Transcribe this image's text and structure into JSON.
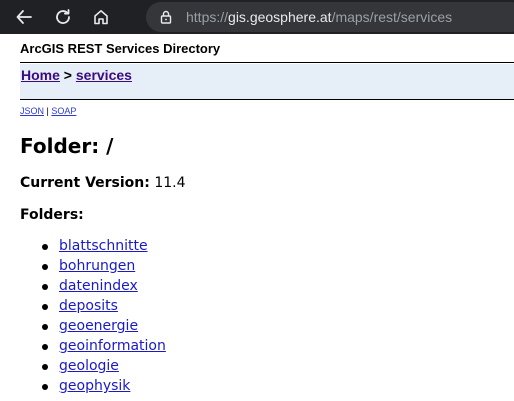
{
  "browser": {
    "url_scheme": "https://",
    "url_host": "gis.geosphere.at",
    "url_path": "/maps/rest/services",
    "icons": [
      "back-arrow-icon",
      "reload-icon",
      "home-icon",
      "lock-icon"
    ]
  },
  "page": {
    "title": "ArcGIS REST Services Directory",
    "breadcrumb": {
      "home_label": "Home",
      "separator": ">",
      "services_label": "services"
    },
    "formats": {
      "json_label": "JSON",
      "separator": "|",
      "soap_label": "SOAP"
    },
    "folder_heading": "Folder: /",
    "version_label": "Current Version:",
    "version_value": "11.4",
    "folders_label": "Folders:",
    "folders": [
      "blattschnitte",
      "bohrungen",
      "datenindex",
      "deposits",
      "geoenergie",
      "geoinformation",
      "geologie",
      "geophysik"
    ]
  },
  "colors": {
    "chrome_bg": "#202124",
    "omnibox_bg": "#35363a",
    "breadcrumb_bg": "#e6eef7",
    "link": "#1a1ac7",
    "visited_link": "#3b0a80"
  }
}
